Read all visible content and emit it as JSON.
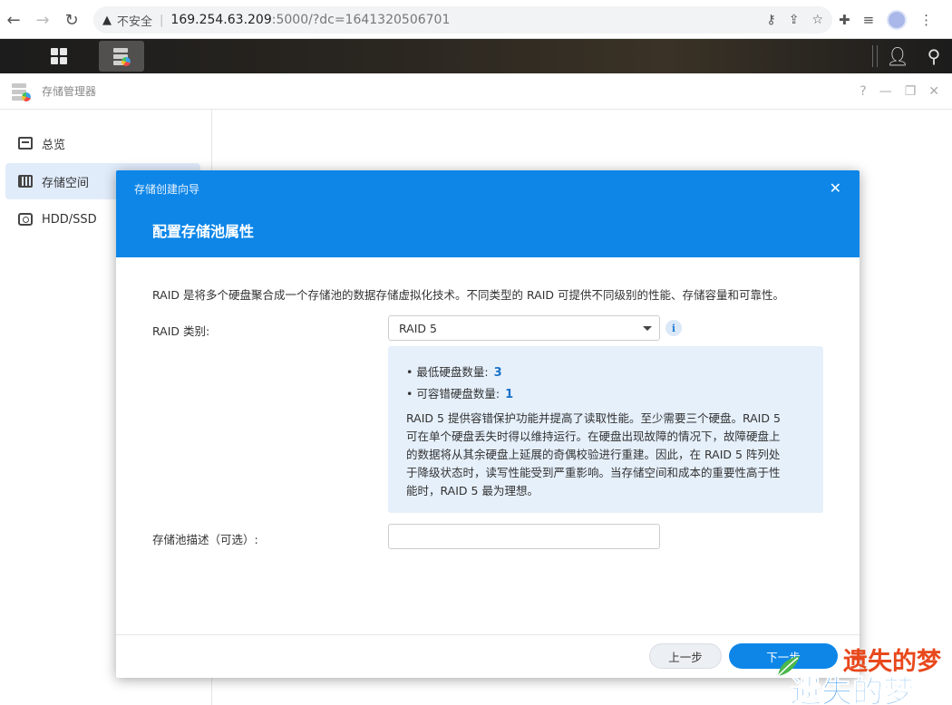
{
  "browser": {
    "security_label": "不安全",
    "url_host": "169.254.63.209",
    "url_rest": ":5000/?dc=1641320506701"
  },
  "app": {
    "title": "存储管理器",
    "window_controls": [
      "?",
      "—",
      "❐",
      "✕"
    ]
  },
  "sidebar": {
    "items": [
      {
        "label": "总览",
        "icon": "overview-icon",
        "active": false
      },
      {
        "label": "存储空间",
        "icon": "storage-icon",
        "active": true
      },
      {
        "label": "HDD/SSD",
        "icon": "hdd-icon",
        "active": false
      }
    ]
  },
  "modal": {
    "wizard_label": "存储创建向导",
    "title": "配置存储池属性",
    "intro": "RAID 是将多个硬盘聚合成一个存储池的数据存储虚拟化技术。不同类型的 RAID 可提供不同级别的性能、存储容量和可靠性。",
    "raid_label": "RAID 类别:",
    "raid_value": "RAID 5",
    "info": {
      "min_disks_label": "最低硬盘数量:",
      "min_disks_value": "3",
      "fault_tolerance_label": "可容错硬盘数量:",
      "fault_tolerance_value": "1",
      "description_lines": [
        "RAID 5 提供容错保护功能并提高了读取性能。至少需要三个硬盘。RAID 5",
        "可在单个硬盘丢失时得以维持运行。在硬盘出现故障的情况下，故障硬盘上",
        "的数据将从其余硬盘上延展的奇偶校验进行重建。因此，在 RAID 5 阵列处",
        "于降级状态时，读写性能受到严重影响。当存储空间和成本的重要性高于性",
        "能时，RAID 5 最为理想。"
      ]
    },
    "desc_label": "存储池描述（可选）:",
    "desc_value": "",
    "prev_button": "上一步",
    "next_button": "下一步"
  },
  "watermark": {
    "top_text": "遗失的梦",
    "bottom_text": "遗失的梦"
  },
  "colors": {
    "accent": "#0d86e8",
    "info_bg": "#e6f0fb",
    "sidebar_active": "#e1ecfb",
    "watermark_red": "#e8481c"
  }
}
